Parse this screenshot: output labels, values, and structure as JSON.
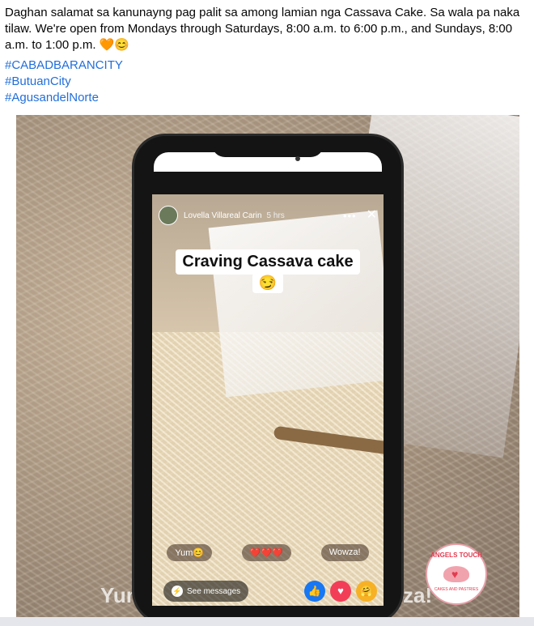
{
  "post": {
    "caption_line1": "Daghan salamat sa kanunayng pag palit sa among lamian nga Cassava Cake. Sa wala pa naka tilaw. We're open from Mondays through Saturdays, 8:00 a.m. to 6:00 p.m., and Sundays, 8:00 a.m. to 1:00 p.m. 🧡😊",
    "hashtags": [
      "#CABADBARANCITY",
      "#ButuanCity",
      "#AgusandelNorte"
    ]
  },
  "photo": {
    "bg_left_word": "Yum",
    "bg_right_word": "za!",
    "story": {
      "author": "Lovella Villareal Carin",
      "time": "5 hrs",
      "menu_icon": "more-dots-icon",
      "close_icon": "close-icon",
      "sticker_text": "Craving Cassava cake",
      "sticker_emoji": "😏",
      "quick_replies": [
        "Yum😊",
        "❤️❤️❤️",
        "Wowza!"
      ],
      "see_messages": "See messages",
      "reactions": [
        "like-icon",
        "love-icon",
        "care-icon"
      ]
    },
    "logo": {
      "top_text": "ANGELS TOUCH",
      "bottom_text": "CAKES AND PASTRIES"
    }
  }
}
